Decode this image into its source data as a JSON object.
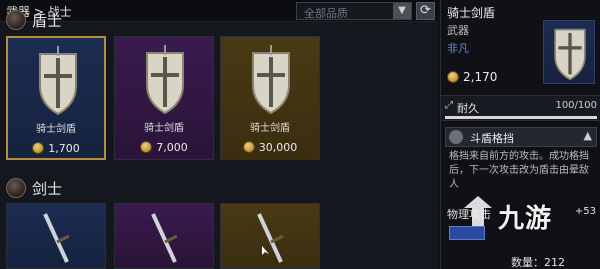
{
  "breadcrumb": "武器 > 战士",
  "filter": {
    "placeholder": "全部品质",
    "arrow": "▼"
  },
  "refresh_icon": "refresh-icon",
  "sections": {
    "shield": {
      "label": "盾士"
    },
    "sword": {
      "label": "剑士"
    }
  },
  "shield_cards": [
    {
      "name": "骑士剑盾",
      "price": "1,700",
      "rarity": "blue"
    },
    {
      "name": "骑士剑盾",
      "price": "7,000",
      "rarity": "purple"
    },
    {
      "name": "骑士剑盾",
      "price": "30,000",
      "rarity": "gold"
    }
  ],
  "detail": {
    "title": "骑士剑盾",
    "type": "武器",
    "rarity": "非凡",
    "price": "2,170",
    "durability_label": "耐久",
    "durability_value": "100/100",
    "durability_fraction": 1.0,
    "skill_name": "斗盾格挡",
    "skill_desc": "格挡来自前方的攻击。成功格挡后，下一次攻击改为盾击由晕敌人",
    "phys_label": "物理攻击",
    "phys_value": "+53",
    "quantity": "数量：212"
  },
  "watermark": "九游",
  "colors": {
    "accent_gold": "#b58d3c",
    "rarity_blue": "#5a8ad8"
  }
}
